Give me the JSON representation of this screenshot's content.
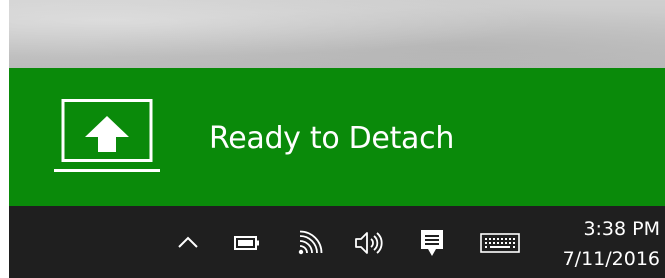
{
  "notification": {
    "message": "Ready to Detach",
    "icon": "detach-laptop-upload-icon",
    "background_color": "#0a8a0a"
  },
  "taskbar": {
    "background_color": "#1f1f1f",
    "tray_icons": [
      {
        "name": "show-hidden-icons",
        "icon": "chevron-up-icon"
      },
      {
        "name": "battery",
        "icon": "battery-icon"
      },
      {
        "name": "network",
        "icon": "wifi-icon"
      },
      {
        "name": "volume",
        "icon": "speaker-icon"
      },
      {
        "name": "action-center",
        "icon": "action-center-icon"
      },
      {
        "name": "touch-keyboard",
        "icon": "keyboard-icon"
      }
    ],
    "clock": {
      "time": "3:38 PM",
      "date": "7/11/2016"
    }
  }
}
